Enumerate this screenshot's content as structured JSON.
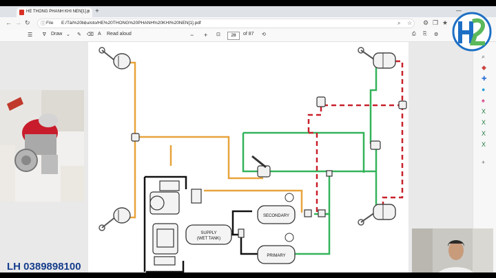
{
  "browser": {
    "tab_title": "HE THONG PHANH KHI NEN[1].p",
    "tab_close": "×",
    "new_tab": "+",
    "file_label": "File",
    "url": "E:/Tài%20liệu/oto/HE%20THONG%20PHANH%20KHI%20NEN[1].pdf"
  },
  "pdf_toolbar": {
    "draw_label": "Draw",
    "read_aloud_label": "Read aloud",
    "zoom_out": "−",
    "zoom_in": "+",
    "page_current": "28",
    "page_total": "of 87"
  },
  "diagram": {
    "secondary_label": "SECONDARY",
    "primary_label": "PRIMARY",
    "supply_label_1": "SUPPLY",
    "supply_label_2": "(WET TANK)"
  },
  "overlay": {
    "phone_text": "LH 0389898100"
  },
  "colors": {
    "orange_line": "#e8a33b",
    "green_line": "#33b35a",
    "red_dash": "#c8202a",
    "black_line": "#111111",
    "phone_text": "#163d8c",
    "logo_blue": "#1d6fc4"
  },
  "icons": [
    "back-icon",
    "forward-icon",
    "reload-icon",
    "pdf-file-icon",
    "search-icon",
    "star-icon",
    "extensions-icon",
    "profile-icon",
    "menu-icon",
    "filter-icon",
    "draw-icon",
    "eraser-icon",
    "read-aloud-icon",
    "fit-page-icon",
    "rotate-icon",
    "print-icon",
    "save-icon",
    "settings-icon"
  ]
}
